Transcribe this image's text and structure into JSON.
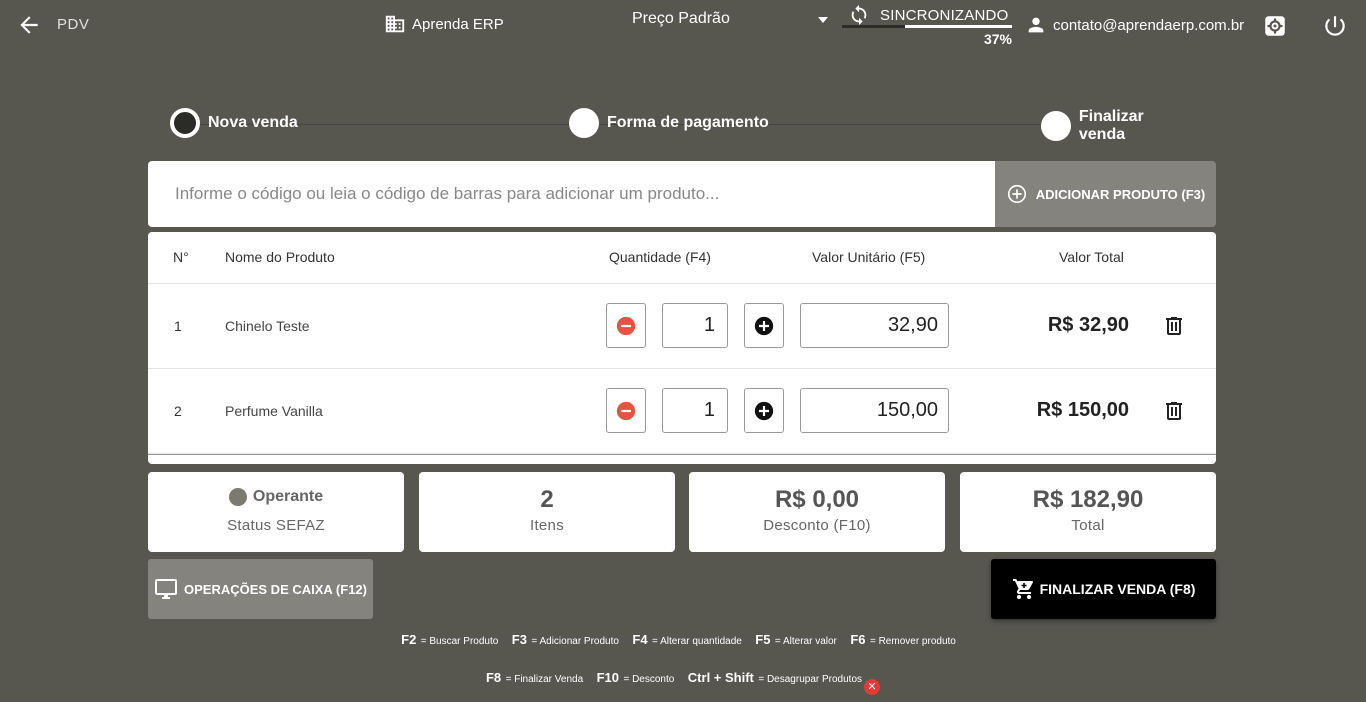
{
  "header": {
    "module": "PDV",
    "company": "Aprenda ERP",
    "price_table": "Preço Padrão",
    "sync_label": "SINCRONIZANDO",
    "sync_percent_text": "37%",
    "sync_progress": 0.37,
    "user_email": "contato@aprendaerp.com.br"
  },
  "steps": [
    {
      "label": "Nova venda"
    },
    {
      "label": "Forma de pagamento"
    },
    {
      "label": "Finalizar venda"
    }
  ],
  "search": {
    "placeholder": "Informe o código ou leia o código de barras para adicionar um produto...",
    "add_button": "ADICIONAR PRODUTO (F3)"
  },
  "table": {
    "headers": {
      "num": "N°",
      "name": "Nome do Produto",
      "qty": "Quantidade (F4)",
      "unit": "Valor Unitário (F5)",
      "total": "Valor Total"
    },
    "rows": [
      {
        "num": "1",
        "name": "Chinelo Teste",
        "qty": "1",
        "unit": "32,90",
        "total": "R$ 32,90"
      },
      {
        "num": "2",
        "name": "Perfume Vanilla",
        "qty": "1",
        "unit": "150,00",
        "total": "R$ 150,00"
      }
    ]
  },
  "summary": {
    "sefaz_status": "Operante",
    "sefaz_label": "Status SEFAZ",
    "items_value": "2",
    "items_label": "Itens",
    "discount_value": "R$ 0,00",
    "discount_label": "Desconto (F10)",
    "total_value": "R$ 182,90",
    "total_label": "Total"
  },
  "actions": {
    "cash_ops": "OPERAÇÕES DE CAIXA (F12)",
    "finalize": "FINALIZAR VENDA (F8)"
  },
  "shortcuts": {
    "line1": [
      {
        "key": "F2",
        "desc": "= Buscar Produto"
      },
      {
        "key": "F3",
        "desc": "= Adicionar Produto"
      },
      {
        "key": "F4",
        "desc": "= Alterar quantidade"
      },
      {
        "key": "F5",
        "desc": "= Alterar valor"
      },
      {
        "key": "F6",
        "desc": "= Remover produto"
      }
    ],
    "line2": [
      {
        "key": "F8",
        "desc": "= Finalizar Venda"
      },
      {
        "key": "F10",
        "desc": "= Desconto"
      },
      {
        "key": "Ctrl + Shift",
        "desc": "= Desagrupar Produtos"
      }
    ],
    "close_glyph": "✕"
  },
  "colors": {
    "background": "#57564f",
    "minus": "#e8533f",
    "sefaz_dot": "#7a7a6e"
  }
}
